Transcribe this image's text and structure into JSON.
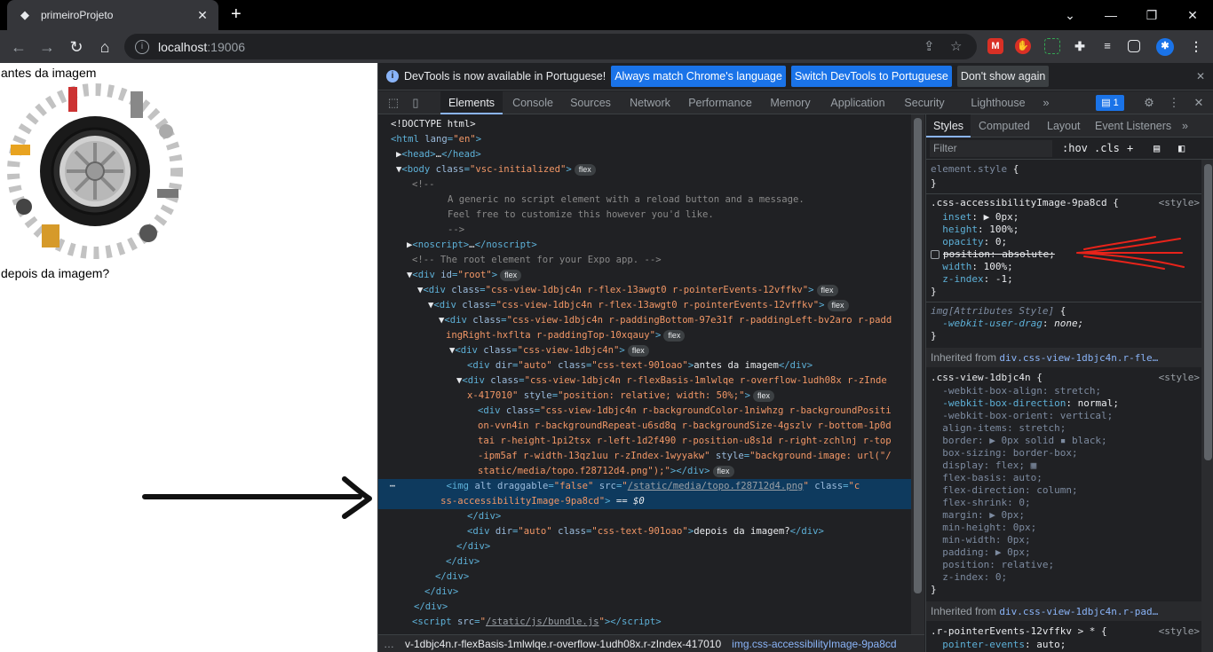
{
  "browser": {
    "tab_title": "primeiroProjeto",
    "url_host": "localhost",
    "url_port": ":19006"
  },
  "page": {
    "text_before": "antes da imagem",
    "text_after": "depois da imagem?"
  },
  "devtools": {
    "info_message": "DevTools is now available in Portuguese!",
    "btn_match": "Always match Chrome's language",
    "btn_switch": "Switch DevTools to Portuguese",
    "btn_dont_show": "Don't show again",
    "tabs": [
      "Elements",
      "Console",
      "Sources",
      "Network",
      "Performance",
      "Memory",
      "Application",
      "Security",
      "Lighthouse"
    ],
    "issues_count": "1",
    "style_tabs": [
      "Styles",
      "Computed",
      "Layout",
      "Event Listeners"
    ],
    "filter_placeholder": "Filter",
    "hov": ":hov",
    "cls": ".cls",
    "breadcrumb_1": "v-1dbjc4n.r-flexBasis-1mlwlqe.r-overflow-1udh08x.r-zIndex-417010",
    "breadcrumb_2": "img.css-accessibilityImage-9pa8cd",
    "inherited_label": "Inherited from",
    "inherited_1": "div.css-view-1dbjc4n.r-fle…",
    "inherited_2": "div.css-view-1dbjc4n.r-pad…",
    "style_source": "<style>"
  }
}
